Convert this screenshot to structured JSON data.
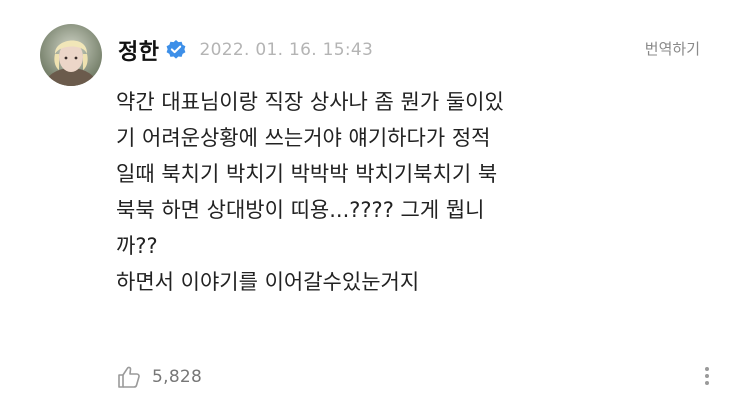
{
  "post": {
    "author": "정한",
    "timestamp": "2022. 01. 16. 15:43",
    "translate_label": "번역하기",
    "lines": [
      "약간 대표님이랑 직장 상사나 좀 뭔가 둘이있",
      "기 어려운상황에 쓰는거야 얘기하다가 정적",
      "일때 북치기 박치기 박박박 박치기북치기 북",
      "북북 하면 상대방이 띠용...???? 그게 뭡니",
      "까??",
      "하면서 이야기를 이어갈수있눈거지"
    ],
    "likes": "5,828"
  },
  "icons": {
    "verified": "verified-badge-icon",
    "like": "thumbs-up-icon",
    "more": "more-vertical-icon"
  },
  "colors": {
    "verified": "#3d8fe8",
    "text": "#222222",
    "muted": "#b4b4b4"
  }
}
